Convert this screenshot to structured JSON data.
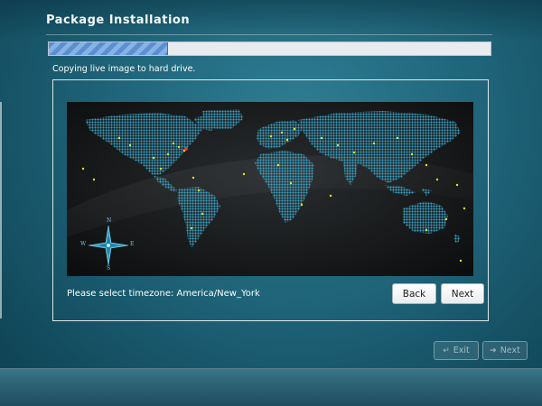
{
  "header": {
    "title": "Package Installation"
  },
  "progress": {
    "fraction": 0.27
  },
  "status": {
    "message": "Copying live image to hard drive."
  },
  "timezone": {
    "prompt": "Please select timezone: America/New_York",
    "back_label": "Back",
    "next_label": "Next"
  },
  "compass": {
    "north": "N",
    "south": "S",
    "east": "E",
    "west": "W"
  },
  "footer": {
    "exit_label": "Exit",
    "next_label": "Next",
    "steps": 4,
    "active_step": 3
  },
  "colors": {
    "background": "#1f6479",
    "land": "#3aa6c8",
    "city": "#f2e01c",
    "selected_city": "#e03a2a",
    "progress_fill": "#5d8fd0"
  }
}
